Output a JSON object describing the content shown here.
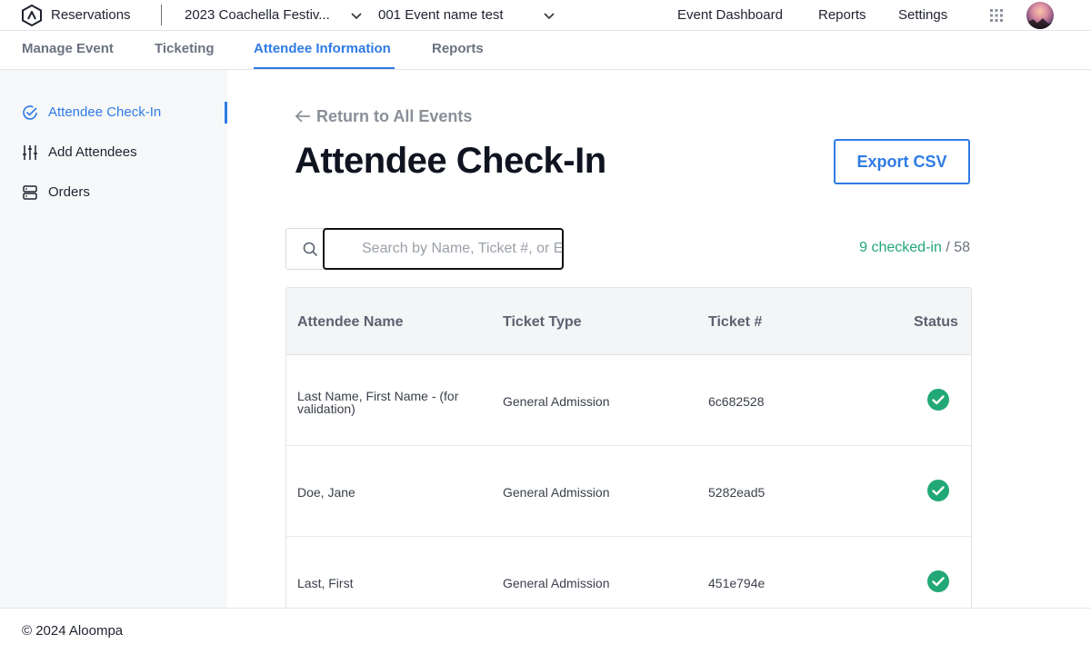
{
  "header": {
    "brand": "Reservations",
    "event_selector": "2023 Coachella Festiv...",
    "event_name_selector": "001 Event name test",
    "nav": [
      "Event Dashboard",
      "Reports",
      "Settings"
    ]
  },
  "tabs": [
    "Manage Event",
    "Ticketing",
    "Attendee Information",
    "Reports"
  ],
  "active_tab": "Attendee Information",
  "sidebar": {
    "items": [
      {
        "label": "Attendee Check-In",
        "icon": "check-circle-icon",
        "active": true
      },
      {
        "label": "Add Attendees",
        "icon": "sliders-icon",
        "active": false
      },
      {
        "label": "Orders",
        "icon": "server-icon",
        "active": false
      }
    ]
  },
  "main": {
    "back_link": "Return to All Events",
    "title": "Attendee Check-In",
    "export_label": "Export CSV",
    "search_placeholder": "Search by Name, Ticket #, or Email",
    "search_value": "",
    "checked_in": "9 checked-in",
    "total": "/ 58"
  },
  "table": {
    "columns": [
      "Attendee Name",
      "Ticket Type",
      "Ticket #",
      "Status"
    ],
    "rows": [
      {
        "name": "Last Name, First Name - (for validation)",
        "type": "General Admission",
        "ticket": "6c682528",
        "status": "checked-in"
      },
      {
        "name": "Doe, Jane",
        "type": "General Admission",
        "ticket": "5282ead5",
        "status": "checked-in"
      },
      {
        "name": "Last, First",
        "type": "General Admission",
        "ticket": "451e794e",
        "status": "checked-in"
      }
    ]
  },
  "footer": {
    "copyright": "© 2024 Aloompa"
  },
  "colors": {
    "accent": "#2f7be5",
    "success": "#22a876",
    "title": "#0f1420"
  }
}
